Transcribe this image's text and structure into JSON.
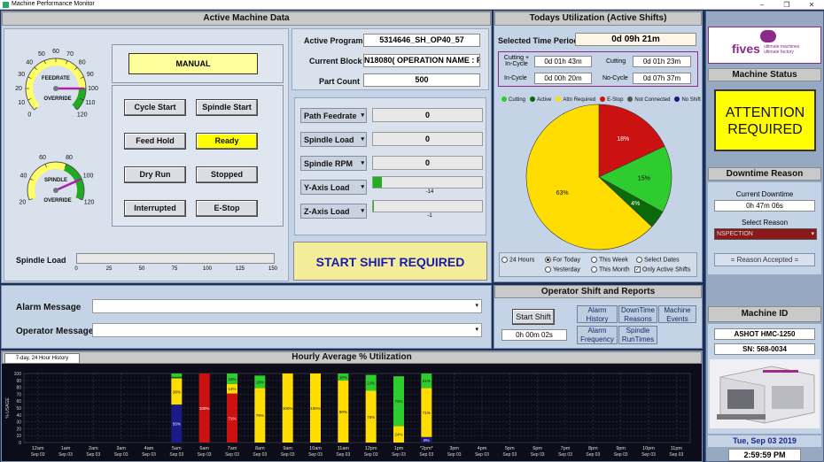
{
  "window": {
    "title": "Machine Performance Monitor",
    "minimize": "–",
    "maximize": "❐",
    "close": "✕"
  },
  "active_machine": {
    "title": "Active Machine Data",
    "mode": "MANUAL",
    "feedrate_gauge": {
      "label": "FEEDRATE",
      "sublabel": "OVERRIDE",
      "ticks": [
        "0",
        "10",
        "20",
        "30",
        "40",
        "50",
        "60",
        "70",
        "80",
        "90",
        "100",
        "110",
        "120"
      ],
      "value_pct": 100
    },
    "spindle_gauge": {
      "label": "SPINDLE",
      "sublabel": "OVERRIDE",
      "ticks": [
        "20",
        "40",
        "60",
        "80",
        "100",
        "120"
      ],
      "value_pct": 100
    },
    "buttons": [
      {
        "label": "Cycle Start",
        "active": false
      },
      {
        "label": "Spindle Start",
        "active": false
      },
      {
        "label": "Feed Hold",
        "active": false
      },
      {
        "label": "Ready",
        "active": true
      },
      {
        "label": "Dry Run",
        "active": false
      },
      {
        "label": "Stopped",
        "active": false
      },
      {
        "label": "Interrupted",
        "active": false
      },
      {
        "label": "E-Stop",
        "active": false
      }
    ],
    "spindle_load": {
      "label": "Spindle Load",
      "ticks": [
        "0",
        "25",
        "50",
        "75",
        "100",
        "125",
        "150"
      ],
      "value": 0
    }
  },
  "program": {
    "active_program_label": "Active Program",
    "active_program": "5314646_SH_OP40_57",
    "current_block_label": "Current Block",
    "current_block": "N18080( OPERATION NAME : FINI",
    "part_count_label": "Part Count",
    "part_count": "500"
  },
  "readouts": [
    {
      "label": "Path Feedrate",
      "value": "0",
      "type": "text"
    },
    {
      "label": "Spindle Load",
      "value": "0",
      "type": "text"
    },
    {
      "label": "Spindle RPM",
      "value": "0",
      "type": "text"
    },
    {
      "label": "Y-Axis Load",
      "value": "-14",
      "type": "bar",
      "fill_pct": 8
    },
    {
      "label": "Z-Axis Load",
      "value": "-1",
      "type": "bar",
      "fill_pct": 1
    }
  ],
  "shift_banner": "START SHIFT REQUIRED",
  "utilization": {
    "title": "Todays Utilization  (Active Shifts)",
    "period_label": "Selected Time Period",
    "period": "0d 09h 21m",
    "cutting_incycle_label": "Cutting +\nIn-Cycle",
    "cutting_incycle": "0d 01h 43m",
    "cutting_label": "Cutting",
    "cutting": "0d 01h 23m",
    "incycle_label": "In-Cycle",
    "incycle": "0d 00h 20m",
    "nocycle_label": "No-Cycle",
    "nocycle": "0d 07h 37m",
    "legend": [
      {
        "name": "Cutting",
        "color": "#2ecc2e"
      },
      {
        "name": "Active",
        "color": "#0a6a0a"
      },
      {
        "name": "Attn Required",
        "color": "#ffdd00"
      },
      {
        "name": "E-Stop",
        "color": "#cc1111"
      },
      {
        "name": "Not Connected",
        "color": "#555555"
      },
      {
        "name": "No Shift",
        "color": "#1a1a88"
      }
    ],
    "pie": [
      {
        "name": "Attn Required",
        "pct": 63,
        "label": "63%",
        "color": "#ffdd00"
      },
      {
        "name": "E-Stop",
        "pct": 18,
        "label": "18%",
        "color": "#cc1111"
      },
      {
        "name": "Cutting",
        "pct": 15,
        "label": "15%",
        "color": "#2ecc2e"
      },
      {
        "name": "Active",
        "pct": 4,
        "label": "4%",
        "color": "#0a6a0a"
      }
    ],
    "radios": [
      {
        "label": "24 Hours",
        "checked": false
      },
      {
        "label": "For Today",
        "checked": true
      },
      {
        "label": "This Week",
        "checked": false
      },
      {
        "label": "Select Dates",
        "checked": false
      },
      {
        "label": "Yesterday",
        "checked": false
      },
      {
        "label": "This Month",
        "checked": false
      }
    ],
    "only_active_label": "Only Active Shifts",
    "only_active_checked": true
  },
  "messages": {
    "alarm_label": "Alarm Message",
    "alarm_value": "",
    "operator_label": "Operator Message",
    "operator_value": ""
  },
  "operator_shift": {
    "title": "Operator Shift and Reports",
    "start_shift": "Start Shift",
    "shift_timer": "0h 00m 02s",
    "reports": [
      "Alarm\nHistory",
      "DownTime\nReasons",
      "Machine\nEvents",
      "Alarm\nFrequency",
      "Spindle\nRunTimes"
    ]
  },
  "sidebar": {
    "logo_text": "fives",
    "logo_tag1": "ultimate machines",
    "logo_tag2": "ultimate factory",
    "status_title": "Machine Status",
    "status_text": "ATTENTION\nREQUIRED",
    "downtime_title": "Downtime Reason",
    "current_downtime_label": "Current Downtime",
    "current_downtime": "0h 47m 06s",
    "select_reason_label": "Select Reason",
    "reason": "NSPECTION",
    "reason_accepted": "= Reason Accepted =",
    "machine_id_title": "Machine ID",
    "machine_name": "ASHOT HMC-1250",
    "serial": "SN: 568-0034",
    "date": "Tue, Sep 03 2019",
    "time": "2:59:59 PM"
  },
  "history": {
    "tab": "7-day, 24 Hour History",
    "title": "Hourly Average % Utilization",
    "ylabel": "% USAGE"
  },
  "chart_data": {
    "type": "bar",
    "title": "Hourly Average % Utilization",
    "ylabel": "% USAGE",
    "ylim": [
      0,
      100
    ],
    "yticks": [
      "0",
      "10",
      "20",
      "30",
      "40",
      "50",
      "60",
      "70",
      "80",
      "90",
      "100"
    ],
    "categories": [
      "12am",
      "1am",
      "2am",
      "3am",
      "4am",
      "5am",
      "6am",
      "7am",
      "8am",
      "9am",
      "10am",
      "11am",
      "12pm",
      "1pm",
      "*2pm*",
      "3pm",
      "4pm",
      "5pm",
      "6pm",
      "7pm",
      "8pm",
      "9pm",
      "10pm",
      "11pm"
    ],
    "sublabels": [
      "Sep 03",
      "Sep 03",
      "Sep 03",
      "Sep 03",
      "Sep 03",
      "Sep 03",
      "Sep 03",
      "Sep 03",
      "Sep 03",
      "Sep 03",
      "Sep 03",
      "Sep 03",
      "Sep 03",
      "Sep 03",
      "Sep 03",
      "Sep 03",
      "Sep 03",
      "Sep 03",
      "Sep 03",
      "Sep 03",
      "Sep 03",
      "Sep 03",
      "Sep 03",
      "Sep 03"
    ],
    "series": [
      {
        "name": "No Shift",
        "color": "#1a1a88",
        "values": [
          0,
          0,
          0,
          0,
          0,
          55,
          0,
          0,
          0,
          0,
          0,
          0,
          0,
          0,
          8,
          0,
          0,
          0,
          0,
          0,
          0,
          0,
          0,
          0
        ],
        "labels": [
          "",
          "",
          "",
          "",
          "",
          "55%",
          "",
          "",
          "",
          "",
          "",
          "",
          "",
          "",
          "8%",
          "",
          "",
          "",
          "",
          "",
          "",
          "",
          "",
          ""
        ]
      },
      {
        "name": "E-Stop",
        "color": "#cc1111",
        "values": [
          0,
          0,
          0,
          0,
          0,
          0,
          100,
          71,
          0,
          0,
          0,
          0,
          0,
          0,
          0,
          0,
          0,
          0,
          0,
          0,
          0,
          0,
          0,
          0
        ],
        "labels": [
          "",
          "",
          "",
          "",
          "",
          "",
          "100%",
          "71%",
          "",
          "",
          "",
          "",
          "",
          "",
          "",
          "",
          "",
          "",
          "",
          "",
          "",
          "",
          "",
          ""
        ]
      },
      {
        "name": "Attn Required",
        "color": "#ffdd00",
        "values": [
          0,
          0,
          0,
          0,
          0,
          38,
          0,
          14,
          79,
          100,
          100,
          90,
          75,
          24,
          71,
          0,
          0,
          0,
          0,
          0,
          0,
          0,
          0,
          0
        ],
        "labels": [
          "",
          "",
          "",
          "",
          "",
          "38%",
          "",
          "14%",
          "79%",
          "100%",
          "100%",
          "90%",
          "75%",
          "24%",
          "71%",
          "",
          "",
          "",
          "",
          "",
          "",
          "",
          "",
          ""
        ]
      },
      {
        "name": "Active",
        "color": "#0a6a0a",
        "values": [
          0,
          0,
          0,
          0,
          0,
          2,
          0,
          0,
          0,
          0,
          0,
          0,
          0,
          0,
          0,
          0,
          0,
          0,
          0,
          0,
          0,
          0,
          0,
          0
        ],
        "labels": [
          "",
          "",
          "",
          "",
          "",
          "",
          "",
          "",
          "",
          "",
          "",
          "",
          "",
          "",
          "",
          "",
          "",
          "",
          "",
          "",
          "",
          "",
          "",
          ""
        ]
      },
      {
        "name": "Cutting",
        "color": "#2ecc2e",
        "values": [
          0,
          0,
          0,
          0,
          0,
          5,
          0,
          15,
          18,
          0,
          0,
          10,
          23,
          72,
          21,
          0,
          0,
          0,
          0,
          0,
          0,
          0,
          0,
          0
        ],
        "labels": [
          "",
          "",
          "",
          "",
          "",
          "",
          "",
          "15%",
          "18%",
          "",
          "",
          "10%",
          "23%",
          "72%",
          "21%",
          "",
          "",
          "",
          "",
          "",
          "",
          "",
          "",
          ""
        ]
      }
    ]
  }
}
